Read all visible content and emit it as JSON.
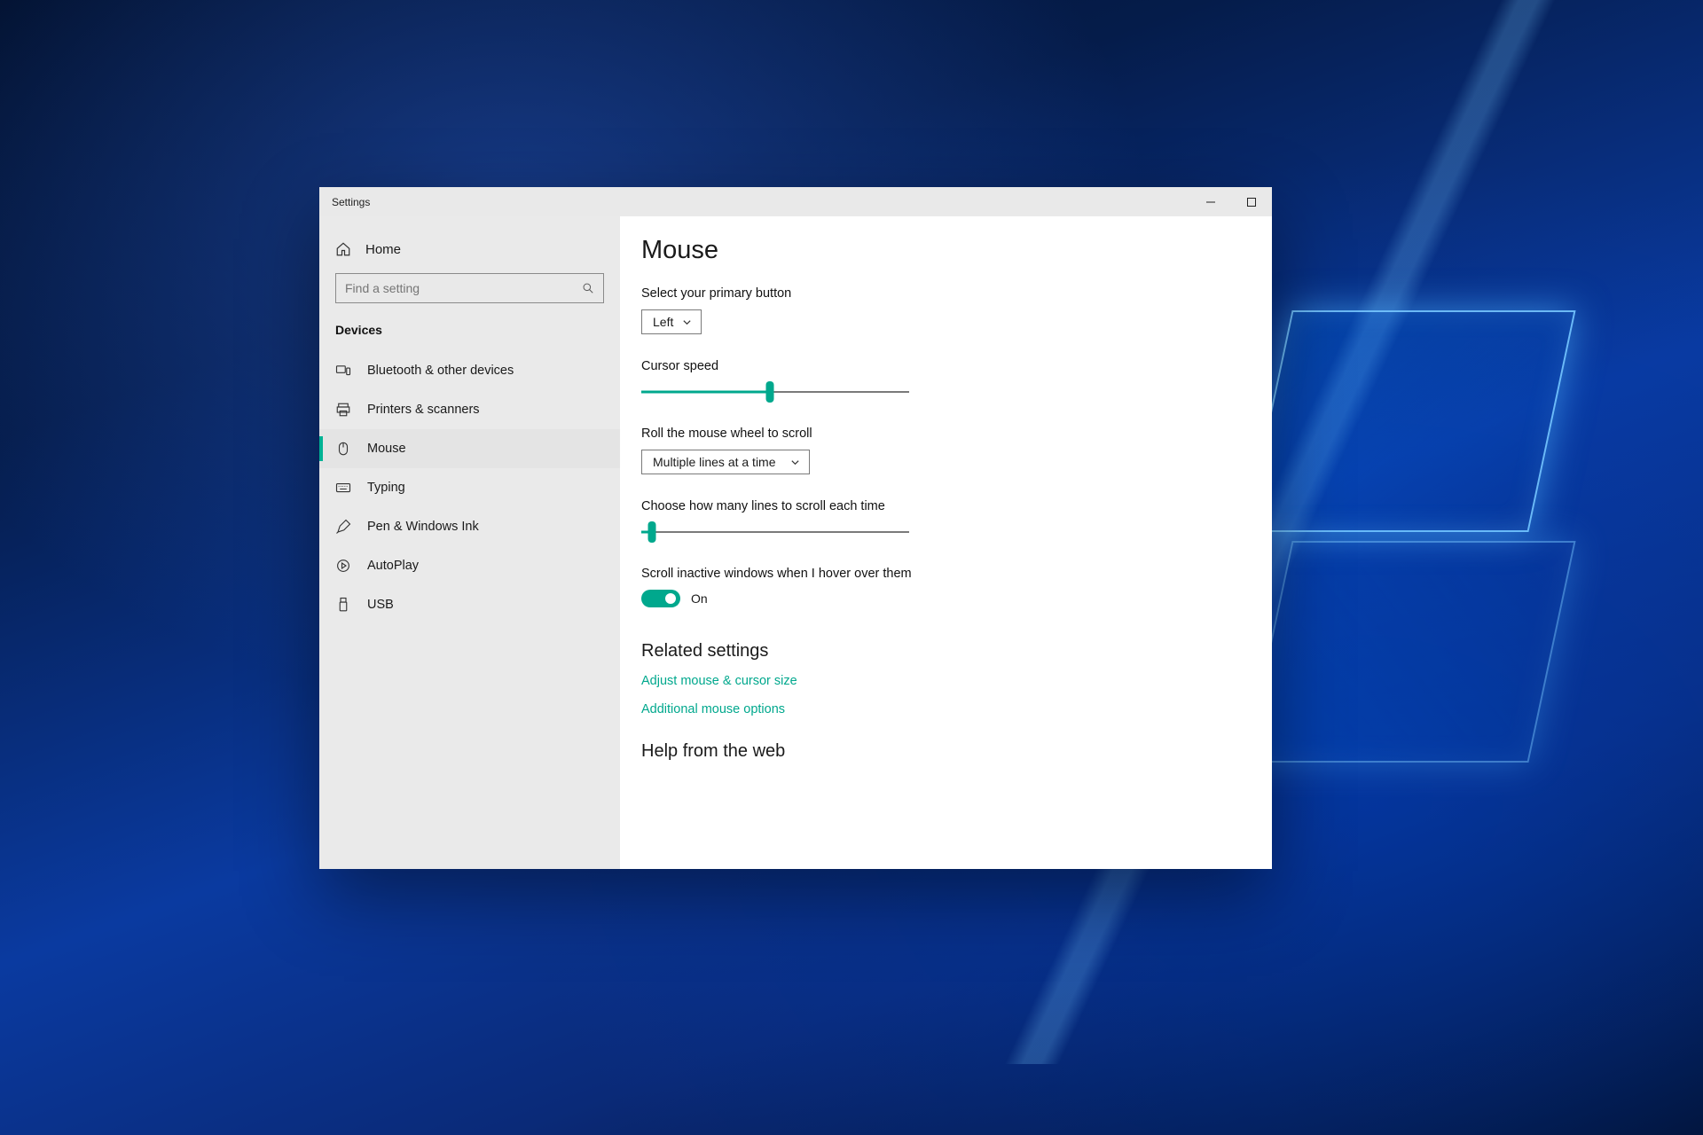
{
  "window": {
    "title": "Settings"
  },
  "sidebar": {
    "home_label": "Home",
    "search_placeholder": "Find a setting",
    "section_label": "Devices",
    "items": [
      {
        "label": "Bluetooth & other devices"
      },
      {
        "label": "Printers & scanners"
      },
      {
        "label": "Mouse"
      },
      {
        "label": "Typing"
      },
      {
        "label": "Pen & Windows Ink"
      },
      {
        "label": "AutoPlay"
      },
      {
        "label": "USB"
      }
    ]
  },
  "main": {
    "title": "Mouse",
    "primary_button_label": "Select your primary button",
    "primary_button_value": "Left",
    "cursor_speed_label": "Cursor speed",
    "cursor_speed_percent": 48,
    "wheel_label": "Roll the mouse wheel to scroll",
    "wheel_value": "Multiple lines at a time",
    "lines_label": "Choose how many lines to scroll each time",
    "lines_percent": 4,
    "inactive_label": "Scroll inactive windows when I hover over them",
    "inactive_state": "On",
    "related_heading": "Related settings",
    "related_links": [
      "Adjust mouse & cursor size",
      "Additional mouse options"
    ],
    "help_heading": "Help from the web"
  }
}
